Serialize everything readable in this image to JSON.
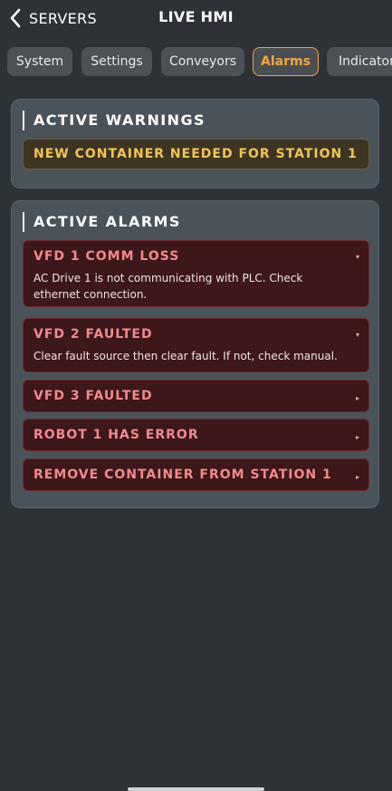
{
  "header": {
    "back_label": "SERVERS",
    "title": "LIVE HMI"
  },
  "tabs": [
    {
      "label": "System"
    },
    {
      "label": "Settings"
    },
    {
      "label": "Conveyors"
    },
    {
      "label": "Alarms",
      "active": true
    },
    {
      "label": "Indicators"
    }
  ],
  "warnings": {
    "title": "ACTIVE WARNINGS",
    "items": [
      {
        "text": "NEW CONTAINER NEEDED FOR STATION 1"
      }
    ]
  },
  "alarms": {
    "title": "ACTIVE ALARMS",
    "items": [
      {
        "title": "VFD 1 COMM LOSS",
        "description": "AC Drive 1 is not communicating with PLC. Check ethernet connection.",
        "expanded": true
      },
      {
        "title": "VFD 2 FAULTED",
        "description": "Clear fault source then clear fault. If not, check manual.",
        "expanded": true
      },
      {
        "title": "VFD 3 FAULTED",
        "expanded": false
      },
      {
        "title": "ROBOT 1 HAS ERROR",
        "expanded": false
      },
      {
        "title": "REMOVE CONTAINER FROM STATION 1",
        "expanded": false
      }
    ]
  },
  "icons": {
    "expanded_arrow": "▾",
    "collapsed_arrow": "▸"
  },
  "colors": {
    "background": "#2e3236",
    "accent": "#f0a742",
    "warning_text": "#f2c35c",
    "alarm_text": "#f08a8e"
  }
}
